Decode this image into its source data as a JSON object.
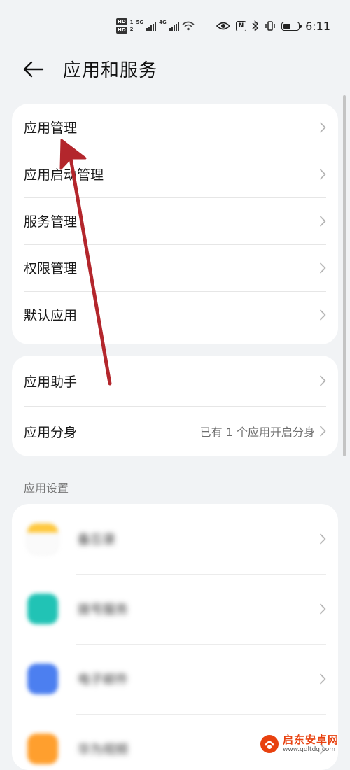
{
  "status_bar": {
    "hd_badges": [
      "HD",
      "HD"
    ],
    "sim_slots": [
      "1",
      "2"
    ],
    "network_types": [
      "5G",
      "4G"
    ],
    "icons": [
      "signal-icon",
      "signal-icon",
      "wifi-icon",
      "eye-icon",
      "nfc-icon",
      "bluetooth-icon",
      "vibrate-icon",
      "battery-icon"
    ],
    "nfc_letter": "N",
    "battery_level": 0.6,
    "time": "6:11"
  },
  "header": {
    "back_icon": "back-arrow-icon",
    "title": "应用和服务"
  },
  "group_1": {
    "items": [
      {
        "label": "应用管理"
      },
      {
        "label": "应用启动管理"
      },
      {
        "label": "服务管理"
      },
      {
        "label": "权限管理"
      },
      {
        "label": "默认应用"
      }
    ]
  },
  "group_2": {
    "items": [
      {
        "label": "应用助手",
        "value": ""
      },
      {
        "label": "应用分身",
        "value": "已有 1 个应用开启分身"
      }
    ]
  },
  "app_settings": {
    "header": "应用设置",
    "apps": [
      {
        "label": "备忘录",
        "icon": "memo-icon",
        "color": "#ffc83d"
      },
      {
        "label": "拨号服务",
        "icon": "phone-icon",
        "color": "#21c3b5"
      },
      {
        "label": "电子邮件",
        "icon": "mail-icon",
        "color": "#4c7ff0"
      },
      {
        "label": "华为视频",
        "icon": "video-icon",
        "color": "#ff9f2e"
      }
    ]
  },
  "colors": {
    "background": "#f1f3f5",
    "card": "#ffffff",
    "annotation_arrow": "#b3262c"
  },
  "watermark": {
    "line1": "启东安卓网",
    "line2": "www.qdltdq.com"
  }
}
